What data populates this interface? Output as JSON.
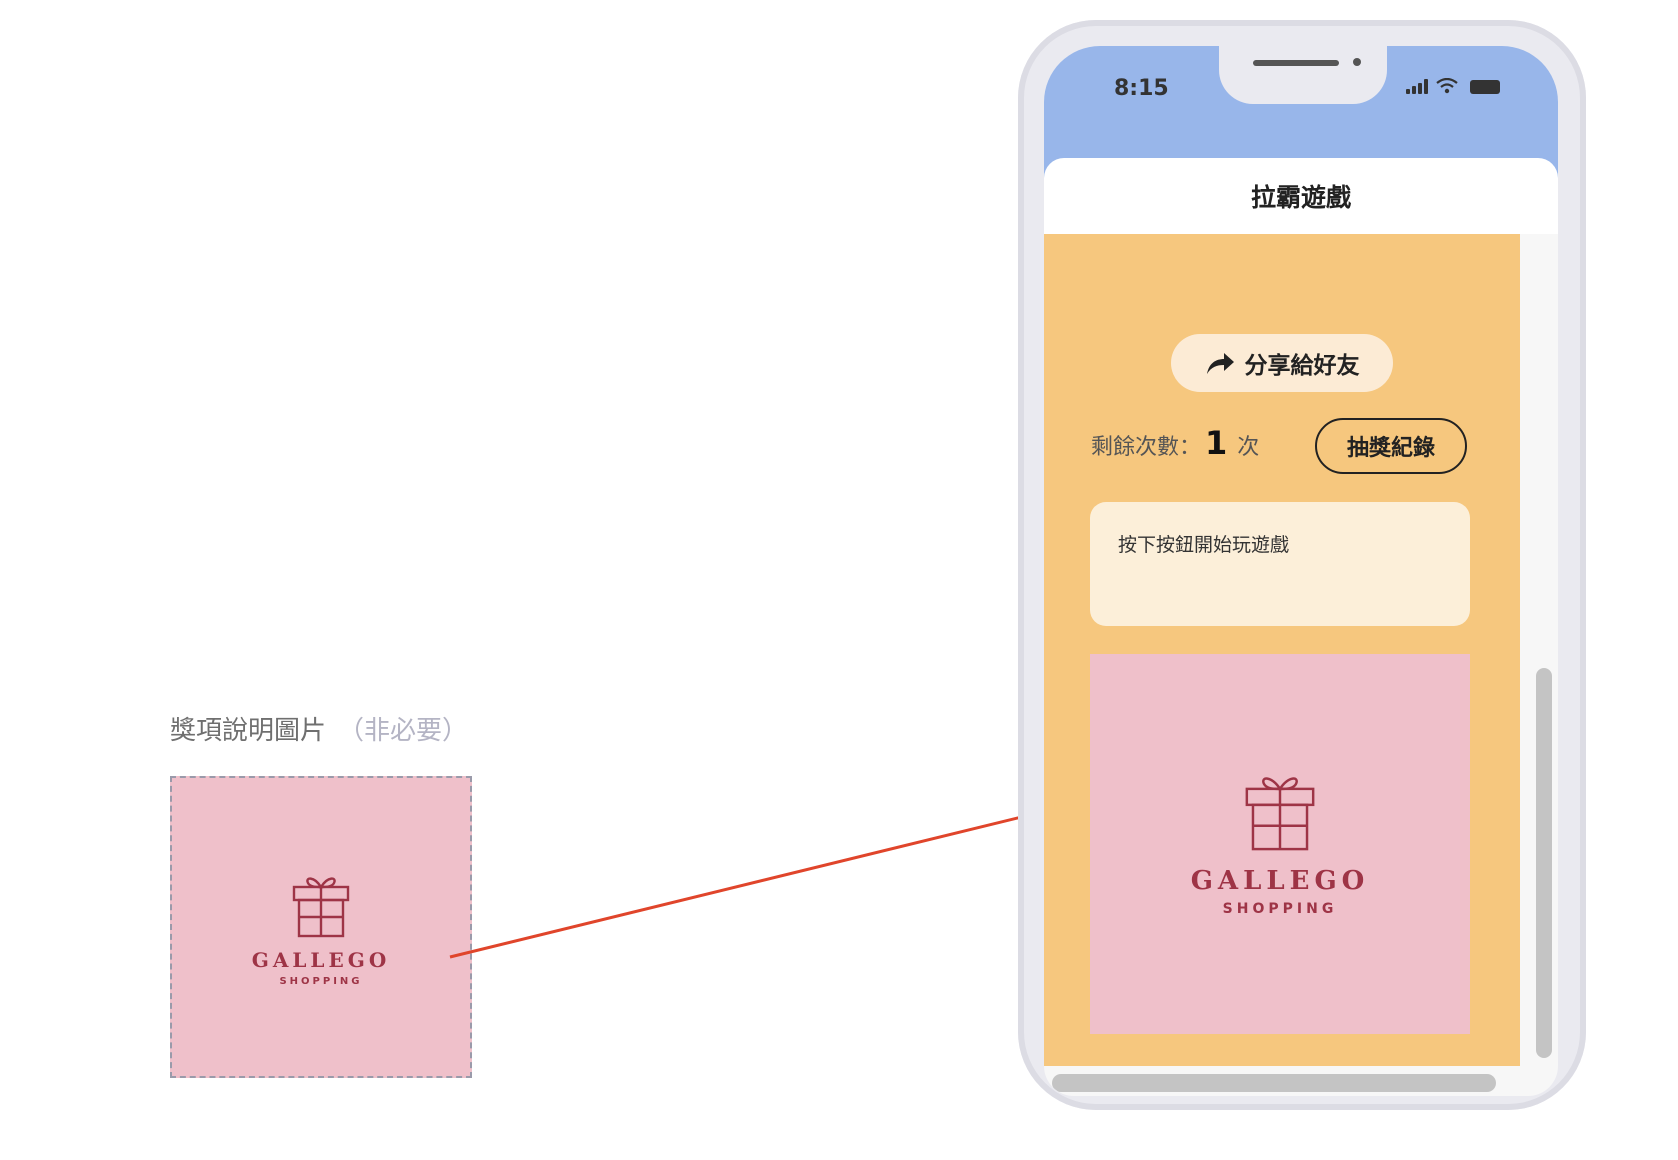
{
  "upload": {
    "label": "獎項說明圖片",
    "optional": "（非必要）",
    "logo_brand": "GALLEGO",
    "logo_sub": "SHOPPING"
  },
  "phone": {
    "status_time": "8:15",
    "title": "拉霸遊戲",
    "share_label": "分享給好友",
    "remaining_label": "剩餘次數：",
    "remaining_count": "1",
    "remaining_unit": "次",
    "record_label": "抽獎紀錄",
    "message": "按下按鈕開始玩遊戲",
    "prize_brand": "GALLEGO",
    "prize_sub": "SHOPPING"
  },
  "colors": {
    "status_bar": "#98b6ea",
    "content_bg": "#f6c77e",
    "prize_bg": "#efc0ca",
    "logo": "#9e3446",
    "arrow": "#e0452b"
  },
  "icons": [
    "gift-icon",
    "share-arrow-icon",
    "signal-icon",
    "wifi-icon",
    "battery-icon"
  ]
}
